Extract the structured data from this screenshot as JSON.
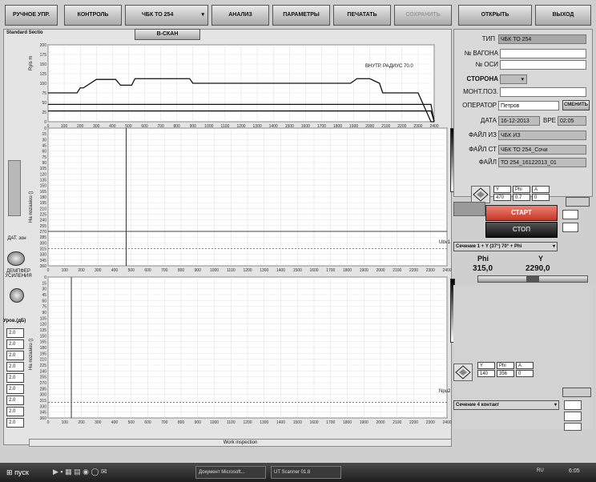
{
  "toolbar": {
    "manual": "РУЧНОЕ УПР.",
    "control": "КОНТРОЛЬ",
    "device": "ЧБК ТО 254",
    "analysis": "АНАЛИЗ",
    "params": "ПАРАМЕТРЫ",
    "print": "ПЕЧАТАТЬ",
    "save": "СОХРАНИТЬ",
    "open": "ОТКРЫТЬ",
    "exit": "ВЫХОД"
  },
  "view_title": "Standard Sectio",
  "bscan_button": "B-СКАН",
  "chart1": {
    "annotation": "ВНУТР. РАДИУС  70.0",
    "ylabel": "Ryis m"
  },
  "chart2": {
    "ylabel": "Ha nozaaiuu ()",
    "marker": "Ubv1"
  },
  "chart3": {
    "ylabel": "Ha nozaaiuu ()",
    "marker": "Npu2"
  },
  "chart_data": [
    {
      "type": "line",
      "title": "",
      "xlabel": "",
      "ylabel": "Ryis m",
      "xlim": [
        0,
        2400
      ],
      "ylim": [
        0,
        200
      ],
      "yticks": [
        0,
        25,
        50,
        75,
        100,
        125,
        150,
        175,
        200
      ],
      "xticks": [
        0,
        100,
        200,
        300,
        400,
        500,
        600,
        700,
        800,
        900,
        1000,
        1100,
        1200,
        1300,
        1400,
        1500,
        1600,
        1700,
        1800,
        1900,
        2000,
        2100,
        2200,
        2300,
        2400
      ],
      "series": [
        {
          "x": [
            0,
            180,
            200,
            220,
            300,
            420,
            450,
            520,
            540,
            560,
            880,
            900,
            1880,
            1920,
            2000,
            2060,
            2080,
            2230,
            2300,
            2380,
            2400
          ],
          "y": [
            75,
            75,
            88,
            88,
            110,
            110,
            95,
            95,
            112,
            112,
            112,
            100,
            100,
            112,
            112,
            100,
            75,
            75,
            75,
            0,
            0
          ]
        },
        {
          "x": [
            0,
            2380,
            2400
          ],
          "y": [
            45,
            45,
            0
          ]
        },
        {
          "x": [
            0,
            2380,
            2400
          ],
          "y": [
            28,
            28,
            0
          ]
        }
      ]
    },
    {
      "type": "scatter",
      "title": "",
      "ylabel": "Ha nozaaiuu ()",
      "xlim": [
        0,
        2400
      ],
      "ylim": [
        0,
        360
      ],
      "yticks": [
        0,
        15,
        30,
        45,
        60,
        75,
        90,
        105,
        120,
        135,
        150,
        165,
        180,
        195,
        210,
        225,
        240,
        255,
        270,
        285,
        300,
        315,
        330,
        345,
        360
      ],
      "xticks": [
        0,
        100,
        200,
        300,
        400,
        500,
        600,
        700,
        800,
        900,
        1000,
        1100,
        1200,
        1300,
        1400,
        1500,
        1600,
        1700,
        1800,
        1900,
        2000,
        2100,
        2200,
        2300,
        2400
      ],
      "cursor_x": 470,
      "cursor_y": 0,
      "threshold_y": 315
    },
    {
      "type": "scatter",
      "title": "",
      "ylabel": "Ha nozaaiuu ()",
      "xlim": [
        0,
        2400
      ],
      "ylim": [
        0,
        360
      ],
      "yticks": [
        0,
        15,
        30,
        45,
        60,
        75,
        90,
        105,
        120,
        135,
        150,
        165,
        180,
        195,
        210,
        225,
        240,
        255,
        270,
        285,
        300,
        315,
        330,
        345,
        360
      ],
      "xticks": [
        0,
        100,
        200,
        300,
        400,
        500,
        600,
        700,
        800,
        900,
        1000,
        1100,
        1200,
        1300,
        1400,
        1500,
        1600,
        1700,
        1800,
        1900,
        2000,
        2100,
        2200,
        2300,
        2400
      ],
      "cursor_x": 140,
      "threshold_y": 320
    }
  ],
  "form": {
    "type_label": "ТИП",
    "type_value": "ЧБК ТО 254",
    "wagon_label": "№ ВАГОНА",
    "wagon_value": "",
    "axle_label": "№ ОСИ",
    "axle_value": "",
    "side_label": "СТОРОНА",
    "mount_label": "МОНТ.ПОЗ.",
    "mount_value": "",
    "operator_label": "ОПЕРАТОР",
    "operator_value": "Петров",
    "change_button": "СМЕНИТЬ",
    "date_label": "ДАТА",
    "date_value": "16-12-2013",
    "time_label": "ВРЕ",
    "time_value": "02:05",
    "file1_label": "ФАЙЛ ИЗ",
    "file1_value": "ЧБК ИЗ",
    "file2_label": "ФАЙЛ СТ",
    "file2_value": "ЧБК ТО 254_Сочи",
    "file3_label": "ФАЙЛ",
    "file3_value": "ТО 254_16122013_01"
  },
  "cursor_table1": {
    "h1": "Y",
    "h2": "Phi",
    "h3": "A",
    "v1": "470",
    "v2": "0.7",
    "v3": "0"
  },
  "cursor_table2": {
    "h1": "Y",
    "h2": "Phi",
    "h3": "A",
    "v1": "140",
    "v2": "356",
    "v3": "0"
  },
  "start_button": "СТАРТ",
  "stop_button": "СТОП",
  "scan_combo": "Сечение 1 + Y (37°) 70° + Phi",
  "phi_label": "Phi",
  "y_label": "Y",
  "phi_value": "315,0",
  "y_value": "2290,0",
  "contact_combo": "Сечение 4 контакт",
  "left_panel": {
    "speed_label": "ДАТ. зон",
    "gain_label": "ДЕМПФЕР УСИЛЕНИЯ",
    "level_label": "Уров.(дБ)",
    "levels": [
      "2.0",
      "2.0",
      "2.0",
      "2.0",
      "2.0",
      "2.0",
      "2.0",
      "2.0",
      "2.0"
    ]
  },
  "status_text": "Work inspection",
  "taskbar": {
    "start": "пуск",
    "task1": "Документ Microsoft...",
    "task2": "UT Scanner 01.8",
    "lang": "RU",
    "clock": "6:05"
  },
  "colors": {
    "accent_start": "#d83b2c",
    "accent_stop": "#1c1c1c"
  }
}
